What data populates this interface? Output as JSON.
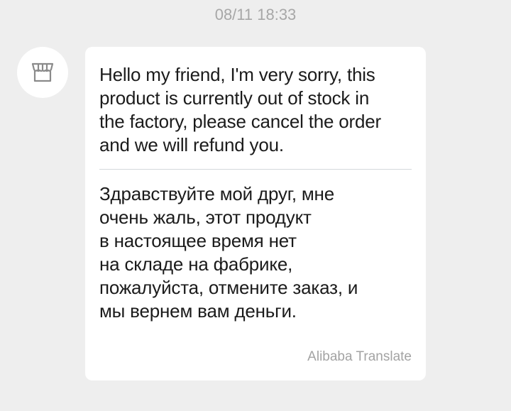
{
  "chat": {
    "timestamp": "08/11 18:33",
    "sender_avatar_icon": "store-icon",
    "message": {
      "original_text": "Hello my friend, I'm very sorry, this\nproduct is currently out of stock in\nthe factory, please cancel the order\nand we will refund you.",
      "translated_text": "Здравствуйте мой друг, мне\nочень жаль, этот продукт\nв настоящее время нет\nна складе на фабрике,\nпожалуйста, отмените заказ, и\nмы вернем вам деньги.",
      "translation_credit": "Alibaba Translate"
    }
  },
  "colors": {
    "background": "#eeeeee",
    "bubble": "#ffffff",
    "text": "#1b1b1b",
    "muted_text": "#a7a7a7",
    "divider": "#d4d9dc"
  }
}
